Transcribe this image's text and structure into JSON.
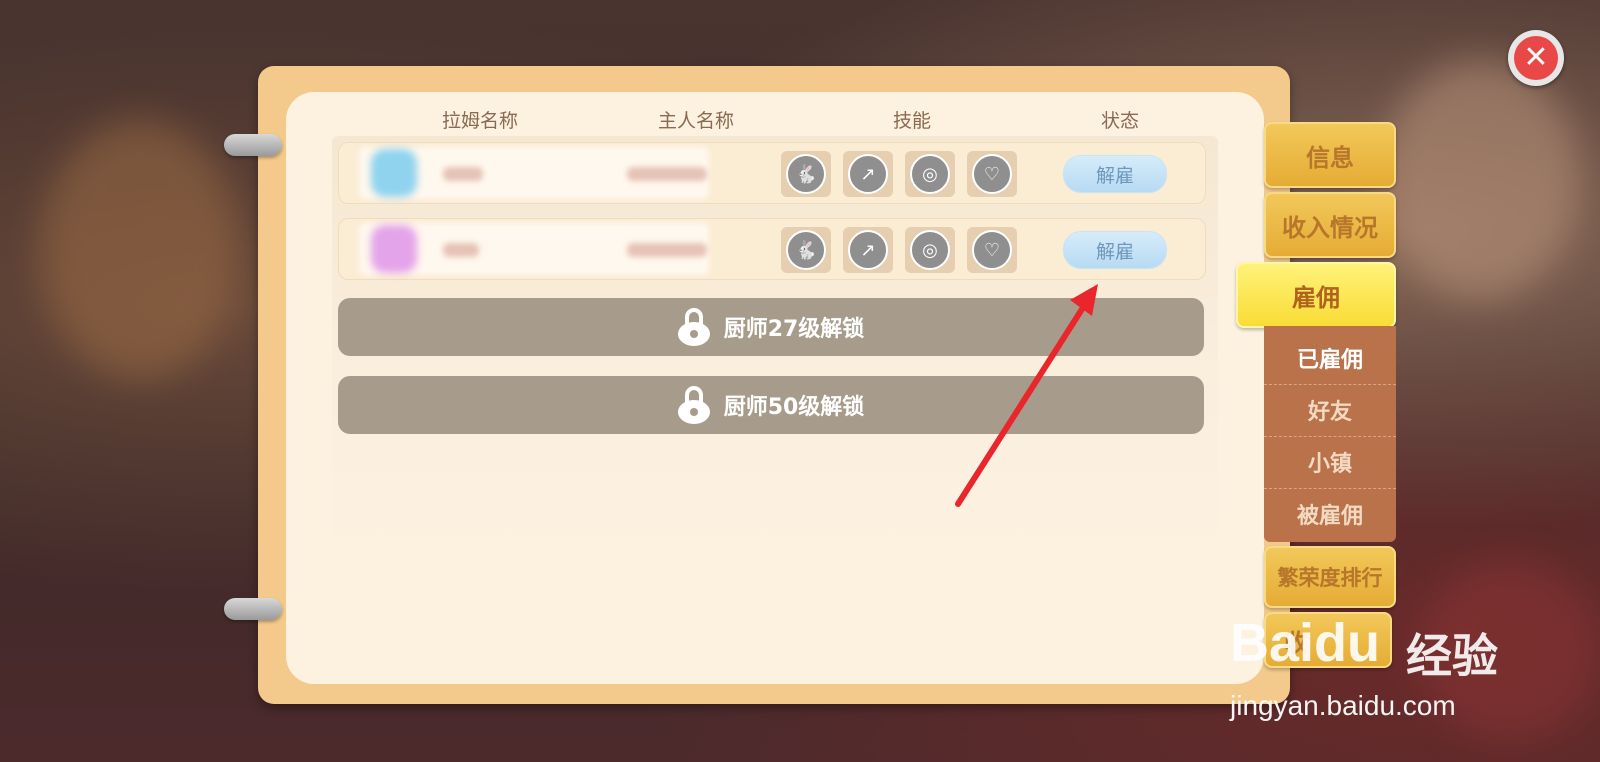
{
  "headers": {
    "pet_name": "拉姆名称",
    "owner_name": "主人名称",
    "skills": "技能",
    "status": "状态"
  },
  "rows": [
    {
      "avatar_color": "#8fd3ef",
      "skills": [
        "bunny-icon",
        "chart-notebook-icon",
        "fish-pan-icon",
        "heart-circle-icon"
      ],
      "action_label": "解雇"
    },
    {
      "avatar_color": "#e3a4ea",
      "skills": [
        "bunny-icon",
        "chart-notebook-icon",
        "fish-pan-icon",
        "heart-circle-icon"
      ],
      "action_label": "解雇"
    }
  ],
  "locked_slots": [
    {
      "label": "厨师27级解锁"
    },
    {
      "label": "厨师50级解锁"
    }
  ],
  "side_tabs": {
    "info": "信息",
    "income": "收入情况",
    "hire": "雇佣",
    "hired": "已雇佣",
    "friends": "好友",
    "town": "小镇",
    "employed": "被雇佣",
    "prosperity": "繁荣度排行",
    "partial": "收"
  },
  "watermark": {
    "brand": "Baidu",
    "brand_cn": "经验",
    "url": "jingyan.baidu.com"
  },
  "colors": {
    "close_button": "#e84848",
    "fire_button": "#b7daf3",
    "active_tab": "#f9dc35",
    "arrow": "#e8262b"
  }
}
